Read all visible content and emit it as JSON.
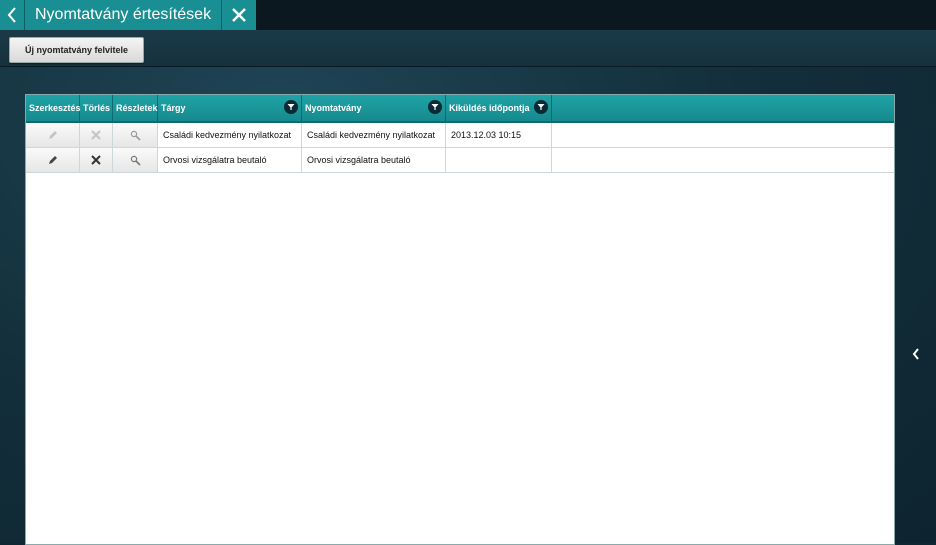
{
  "window": {
    "title": "Nyomtatvány értesítések"
  },
  "icons": {
    "back": "chevron-left-icon",
    "close": "close-icon",
    "filter": "filter-icon",
    "edit": "pencil-icon",
    "delete": "x-icon",
    "details": "magnifier-icon",
    "side": "chevron-left-icon"
  },
  "toolbar": {
    "new_label": "Új nyomtatvány felvitele"
  },
  "grid": {
    "columns": [
      "Szerkesztés",
      "Törlés",
      "Részletek",
      "Tárgy",
      "Nyomtatvány",
      "Kiküldés időpontja"
    ],
    "rows": [
      {
        "subject": "Családi kedvezmény nyilatkozat",
        "form": "Családi kedvezmény nyilatkozat",
        "sent": "2013.12.03 10:15",
        "enabled": false
      },
      {
        "subject": "Orvosi vizsgálatra beutaló",
        "form": "Orvosi vizsgálatra beutaló",
        "sent": "",
        "enabled": true
      }
    ]
  },
  "colors": {
    "accent": "#1a8f93",
    "header": "#1fa3a6",
    "background": "#0f2733"
  }
}
